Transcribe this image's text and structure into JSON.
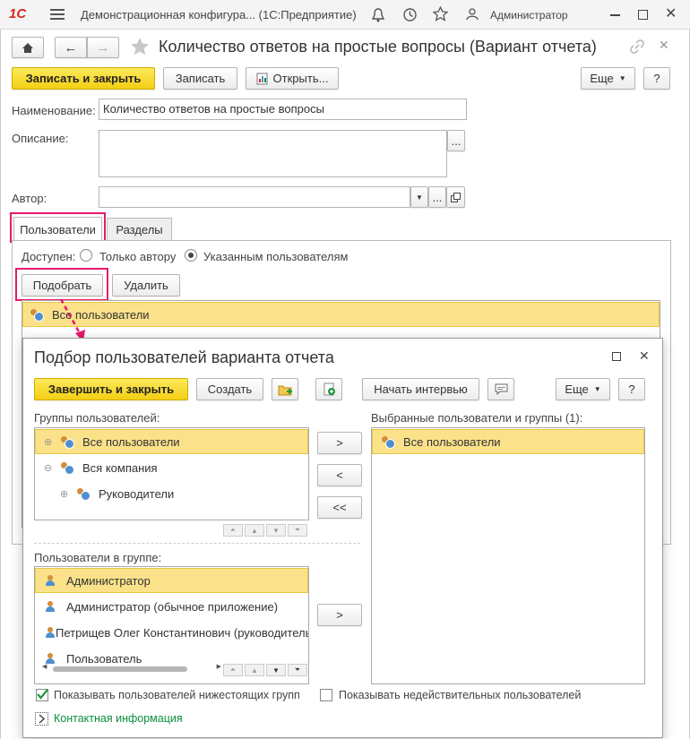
{
  "titlebar": {
    "logo": "1С",
    "title": "Демонстрационная конфигура... (1С:Предприятие)",
    "user": "Администратор"
  },
  "main_window": {
    "title": "Количество ответов на простые вопросы (Вариант отчета)",
    "btn_save_close": "Записать и закрыть",
    "btn_save": "Записать",
    "btn_open": "Открыть...",
    "btn_more": "Еще",
    "btn_help": "?",
    "label_name": "Наименование:",
    "value_name": "Количество ответов на простые вопросы",
    "label_description": "Описание:",
    "value_description": "",
    "label_author": "Автор:",
    "value_author": "",
    "select_btn": "...",
    "tabs": [
      "Пользователи",
      "Разделы"
    ],
    "label_available": "Доступен:",
    "radio_only_author": "Только автору",
    "radio_specified": "Указанным пользователям",
    "btn_pick": "Подобрать",
    "btn_delete": "Удалить",
    "list_items": [
      "Все пользователи"
    ]
  },
  "dialog": {
    "title": "Подбор пользователей варианта отчета",
    "btn_finish": "Завершить и закрыть",
    "btn_create": "Создать",
    "btn_interview": "Начать интервью",
    "btn_more": "Еще",
    "btn_help": "?",
    "label_groups": "Группы пользователей:",
    "groups": [
      {
        "expander": "⊕",
        "label": "Все пользователи"
      },
      {
        "expander": "⊖",
        "label": "Вся компания"
      },
      {
        "expander": "⊕",
        "label": "Руководители"
      }
    ],
    "label_selected": "Выбранные пользователи и группы (1):",
    "selected": [
      "Все пользователи"
    ],
    "btn_add": ">",
    "btn_remove": "<",
    "btn_remove_all": "<<",
    "btn_add_user": ">",
    "label_users_in_group": "Пользователи в группе:",
    "users": [
      "Администратор",
      "Администратор (обычное приложение)",
      "Петрищев Олег Константинович (руководитель)",
      "Пользователь"
    ],
    "check_subordinate": "Показывать пользователей нижестоящих групп",
    "check_invalid": "Показывать недействительных пользователей",
    "contact_info": "Контактная информация"
  },
  "colors": {
    "accent_yellow": "#f5d41c",
    "highlight_pink": "#e8186e",
    "selection": "#fbe28a",
    "logo_red": "#d8261c",
    "link_green": "#0a8f3c"
  }
}
